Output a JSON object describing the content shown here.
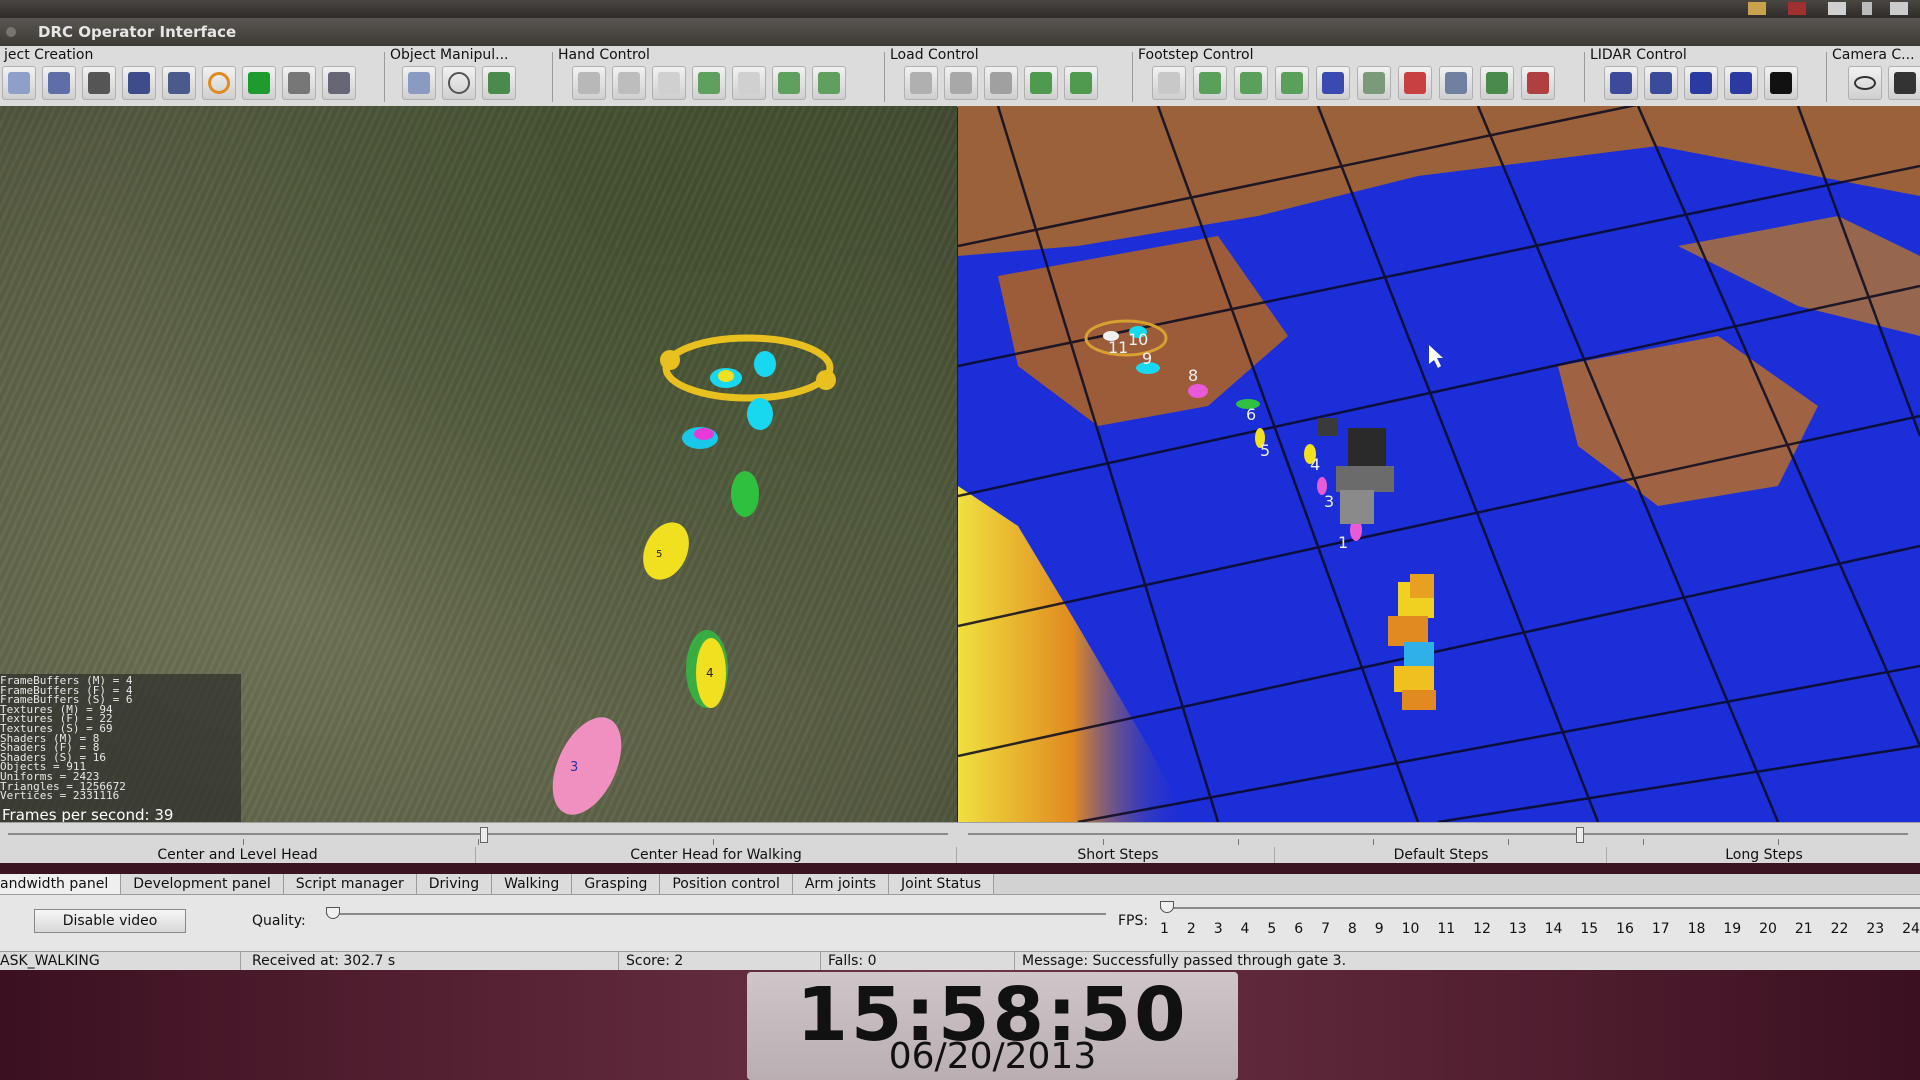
{
  "window": {
    "title": "DRC Operator Interface"
  },
  "toolbar": {
    "groups": [
      {
        "label": "ject Creation"
      },
      {
        "label": "Object Manipul..."
      },
      {
        "label": "Hand Control"
      },
      {
        "label": "Load Control"
      },
      {
        "label": "Footstep Control"
      },
      {
        "label": "LIDAR Control"
      },
      {
        "label": "Camera C..."
      }
    ]
  },
  "camera_view": {
    "stats": [
      "FrameBuffers (M) = 4",
      "FrameBuffers (F) = 4",
      "FrameBuffers (S) = 6",
      "Textures (M) = 94",
      "Textures (F) = 22",
      "Textures (S) = 69",
      "Shaders (M) = 8",
      "Shaders (F) = 8",
      "Shaders (S) = 16",
      "Objects = 911",
      "Uniforms = 2423",
      "Triangles = 1256672",
      "Vertices = 2331116"
    ],
    "fps_text": "Frames per second: 39",
    "footstep_numbers": [
      "3",
      "4",
      "5"
    ]
  },
  "map_view": {
    "footstep_numbers": [
      "1",
      "3",
      "4",
      "5",
      "6",
      "8",
      "9",
      "10",
      "11"
    ]
  },
  "sliders": {
    "head_left": "Center and Level Head",
    "head_right": "Center Head for Walking",
    "steps_short": "Short Steps",
    "steps_default": "Default Steps",
    "steps_long": "Long Steps"
  },
  "tabs": [
    {
      "label": "andwidth panel",
      "active": true
    },
    {
      "label": "Development panel"
    },
    {
      "label": "Script manager"
    },
    {
      "label": "Driving"
    },
    {
      "label": "Walking"
    },
    {
      "label": "Grasping"
    },
    {
      "label": "Position control"
    },
    {
      "label": "Arm joints"
    },
    {
      "label": "Joint Status"
    }
  ],
  "bandwidth": {
    "disable_video_label": "Disable video",
    "quality_label": "Quality:",
    "fps_label": "FPS:",
    "fps_ticks": [
      "1",
      "2",
      "3",
      "4",
      "5",
      "6",
      "7",
      "8",
      "9",
      "10",
      "11",
      "12",
      "13",
      "14",
      "15",
      "16",
      "17",
      "18",
      "19",
      "20",
      "21",
      "22",
      "23",
      "24"
    ]
  },
  "status": {
    "task": "ASK_WALKING",
    "received": "Received at:  302.7 s",
    "score": "Score:  2",
    "falls": "Falls:  0",
    "message": "Message:  Successfully passed through gate 3."
  },
  "clock": {
    "time": "15:58:50",
    "date": "06/20/2013"
  }
}
